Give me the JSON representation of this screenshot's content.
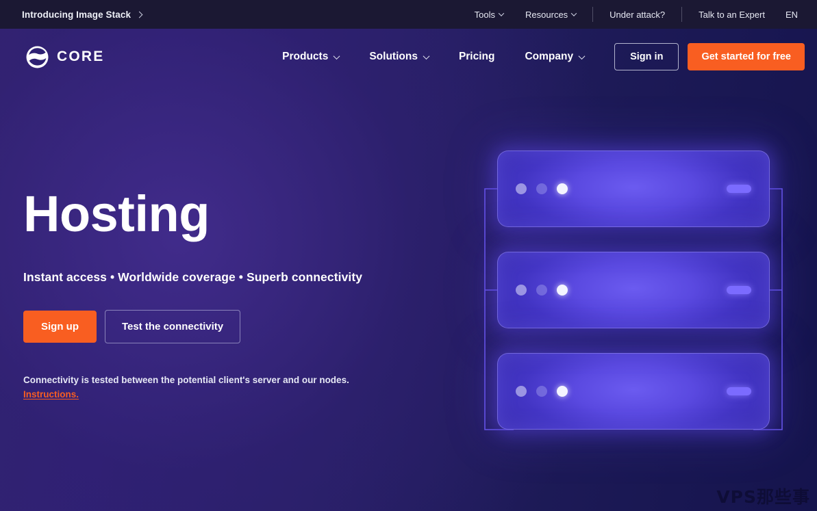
{
  "topbar": {
    "announcement": {
      "label": "Introducing Image Stack",
      "icon": "chevron-right-icon"
    },
    "items": [
      {
        "label": "Tools",
        "icon": "chevron-down-icon",
        "has_caret": true
      },
      {
        "label": "Resources",
        "icon": "chevron-down-icon",
        "has_caret": true
      },
      {
        "label": "Under attack?",
        "has_caret": false
      },
      {
        "label": "Talk to an Expert",
        "has_caret": false
      },
      {
        "label": "EN",
        "has_caret": false
      }
    ]
  },
  "nav": {
    "logo_text": "CORE",
    "logo_icon": "gcore-g-logo-icon",
    "links": [
      {
        "label": "Products",
        "has_caret": true
      },
      {
        "label": "Solutions",
        "has_caret": true
      },
      {
        "label": "Pricing",
        "has_caret": false
      },
      {
        "label": "Company",
        "has_caret": true
      }
    ],
    "sign_in": "Sign in",
    "get_started": "Get started for free"
  },
  "hero": {
    "title": "Hosting",
    "subtitle": "Instant access • Worldwide coverage • Superb connectivity",
    "primary_cta": "Sign up",
    "secondary_cta": "Test the connectivity",
    "note": "Connectivity is tested between the potential client's server and our nodes.",
    "note_link": "Instructions."
  },
  "illustration": {
    "name": "server-rack-illustration",
    "server_count": 3,
    "dots_per_server": 3,
    "indicator": "status-pill"
  },
  "watermark": "VPS那些事",
  "colors": {
    "accent_orange": "#f95e21",
    "bg_purple_left": "#2e2173",
    "bg_navy_right": "#15144d",
    "topbar_dark": "#1b1833",
    "server_glow": "#6b5bf0",
    "text_white": "#ffffff"
  }
}
